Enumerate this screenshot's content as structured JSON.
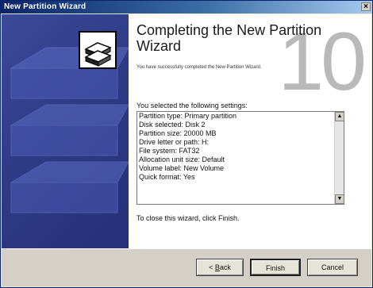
{
  "window": {
    "title": "New Partition Wizard",
    "close_glyph": "×"
  },
  "content": {
    "heading": "Completing the New Partition Wizard",
    "success_message": "You have successfully completed the New Partition Wizard.",
    "selected_label": "You selected the following settings:",
    "settings": [
      "Partition type: Primary partition",
      "Disk selected: Disk 2",
      "Partition size: 20000 MB",
      "Drive letter or path: H:",
      "File system: FAT32",
      "Allocation unit size: Default",
      "Volume label: New Volume",
      "Quick format: Yes"
    ],
    "close_instruction": "To close this wizard, click Finish.",
    "overlay_number": "10"
  },
  "buttons": {
    "back_prefix": "< ",
    "back_key": "B",
    "back_rest": "ack",
    "finish": "Finish",
    "cancel": "Cancel"
  },
  "icons": {
    "scroll_up": "scroll-up-arrow-icon",
    "scroll_down": "scroll-down-arrow-icon",
    "wizard": "disk-stack-wizard-icon"
  }
}
